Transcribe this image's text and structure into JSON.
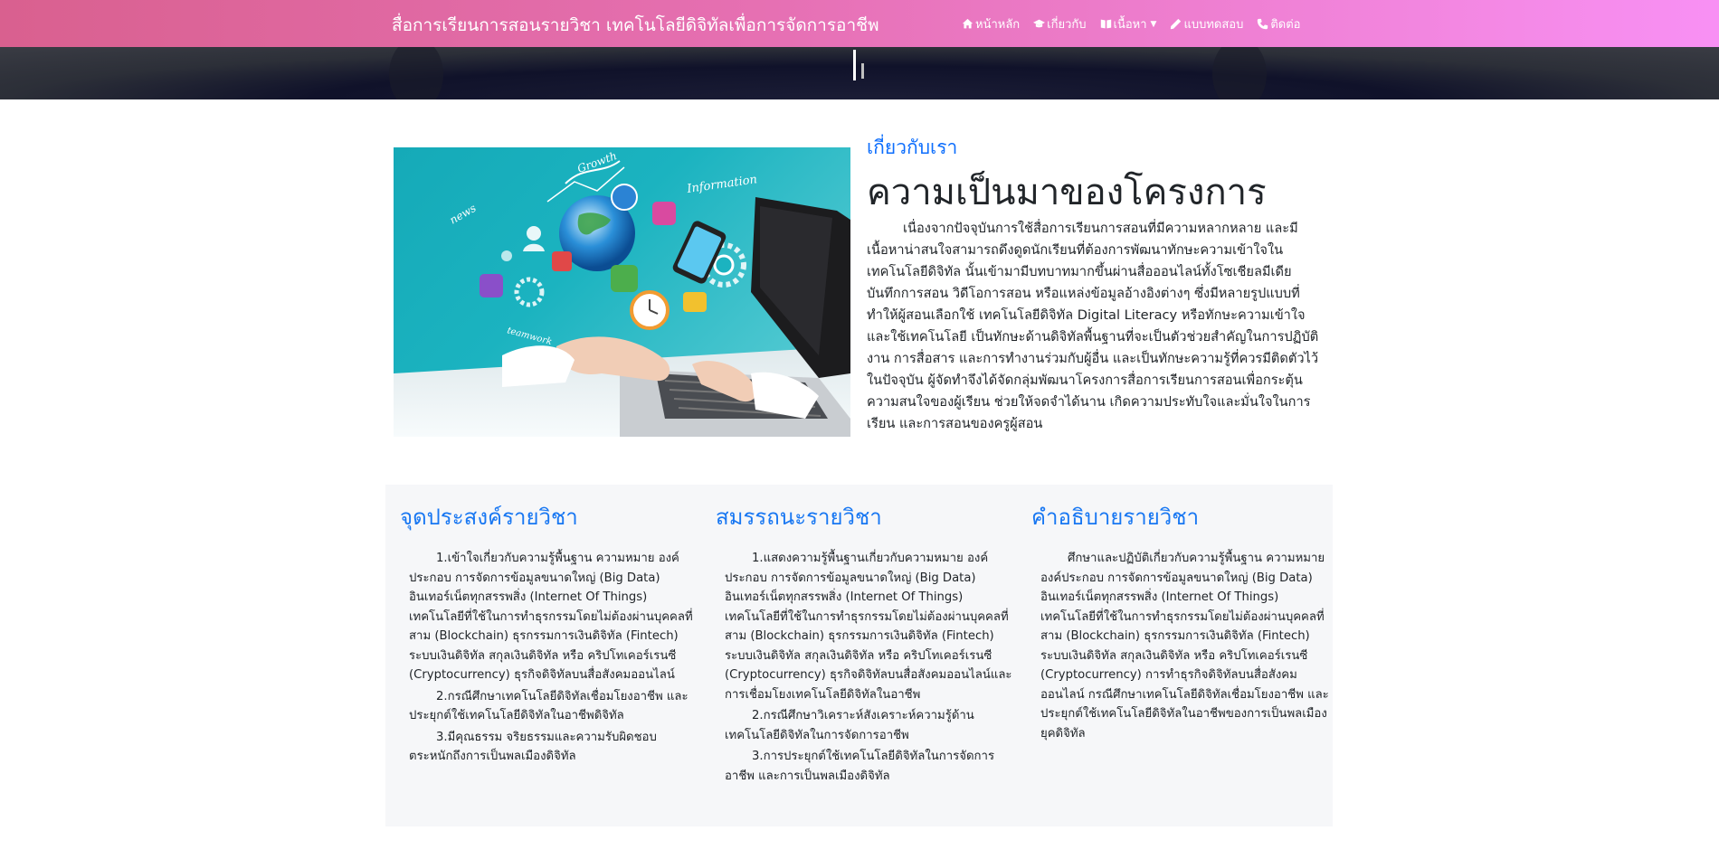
{
  "navbar": {
    "brand": "สื่อการเรียนการสอนรายวิชา เทคโนโลยีดิจิทัลเพื่อการจัดการอาชีพ",
    "links": [
      {
        "label": "หน้าหลัก",
        "icon": "home-icon"
      },
      {
        "label": "เกี่ยวกับ",
        "icon": "graduation-cap-icon"
      },
      {
        "label": "เนื้อหา",
        "icon": "book-icon",
        "dropdown": true
      },
      {
        "label": "แบบทดสอบ",
        "icon": "pencil-icon"
      },
      {
        "label": "ติดต่อ",
        "icon": "phone-icon"
      }
    ]
  },
  "about": {
    "subtitle": "เกี่ยวกับเรา",
    "title": "ความเป็นมาของโครงการ",
    "body": "เนื่องจากปัจจุบันการใช้สื่อการเรียนการสอนที่มีความหลากหลาย และมีเนื้อหาน่าสนใจสามารถดึงดูดนักเรียนที่ต้องการพัฒนาทักษะความเข้าใจในเทคโนโลยีดิจิทัล นั้นเข้ามามีบทบาทมากขึ้นผ่านสื่อออนไลน์ทั้งโซเชียลมีเดีย บันทึกการสอน วิดีโอการสอน หรือแหล่งข้อมูลอ้างอิงต่างๆ ซึ่งมีหลายรูปแบบที่ทำให้ผู้สอนเลือกใช้ เทคโนโลยีดิจิทัล Digital Literacy หรือทักษะความเข้าใจและใช้เทคโนโลยี เป็นทักษะด้านดิจิทัลพื้นฐานที่จะเป็นตัวช่วยสำคัญในการปฏิบัติงาน การสื่อสาร และการทำงานร่วมกับผู้อื่น และเป็นทักษะความรู้ที่ควรมีติดตัวไว้ในปัจจุบัน ผู้จัดทำจึงได้จัดกลุ่มพัฒนาโครงการสื่อการเรียนการสอนเพื่อกระตุ้นความสนใจของผู้เรียน ช่วยให้จดจำได้นาน เกิดความประทับใจและมั่นใจในการเรียน และการสอนของครูผู้สอน",
    "image_label_1": "Growth",
    "image_label_2": "Information",
    "image_label_3": "news",
    "image_label_4": "teamwork"
  },
  "cards": [
    {
      "title": "จุดประสงค์รายวิชา",
      "paragraphs": [
        "1.เข้าใจเกี่ยวกับความรู้พื้นฐาน ความหมาย องค์ประกอบ การจัดการข้อมูลขนาดใหญ่ (Big Data) อินเทอร์เน็ตทุกสรรพสิ่ง (Internet Of Things) เทคโนโลยีที่ใช้ในการทำธุรกรรมโดยไม่ต้องผ่านบุคคลที่สาม (Blockchain) ธุรกรรมการเงินดิจิทัล (Fintech) ระบบเงินดิจิทัล สกุลเงินดิจิทัล หรือ คริปโทเคอร์เรนซี (Cryptocurrency) ธุรกิจดิจิทัลบนสื่อสังคมออนไลน์",
        "2.กรณีศึกษาเทคโนโลยีดิจิทัลเชื่อมโยงอาชีพ และประยุกต์ใช้เทคโนโลยีดิจิทัลในอาชีพดิจิทัล",
        "3.มีคุณธรรม จริยธรรมและความรับผิดชอบ ตระหนักถึงการเป็นพลเมืองดิจิทัล"
      ]
    },
    {
      "title": "สมรรถนะรายวิชา",
      "paragraphs": [
        "1.แสดงความรู้พื้นฐานเกี่ยวกับความหมาย องค์ประกอบ การจัดการข้อมูลขนาดใหญ่ (Big Data) อินเทอร์เน็ตทุกสรรพสิ่ง (Internet Of Things) เทคโนโลยีที่ใช้ในการทำธุรกรรมโดยไม่ต้องผ่านบุคคลที่สาม (Blockchain) ธุรกรรมการเงินดิจิทัล (Fintech) ระบบเงินดิจิทัล สกุลเงินดิจิทัล หรือ คริปโทเคอร์เรนซี (Cryptocurrency) ธุรกิจดิจิทัลบนสื่อสังคมออนไลน์และการเชื่อมโยงเทคโนโลยีดิจิทัลในอาชีพ",
        "2.กรณีศึกษาวิเคราะห์สังเคราะห์ความรู้ด้านเทคโนโลยีดิจิทัลในการจัดการอาชีพ",
        "3.การประยุกต์ใช้เทคโนโลยีดิจิทัลในการจัดการอาชีพ และการเป็นพลเมืองดิจิทัล"
      ]
    },
    {
      "title": "คำอธิบายรายวิชา",
      "paragraphs": [
        "ศึกษาและปฏิบัติเกี่ยวกับความรู้พื้นฐาน ความหมาย องค์ประกอบ การจัดการข้อมูลขนาดใหญ่ (Big Data) อินเทอร์เน็ตทุกสรรพสิ่ง (Internet Of Things) เทคโนโลยีที่ใช้ในการทำธุรกรรมโดยไม่ต้องผ่านบุคคลที่สาม (Blockchain) ธุรกรรมการเงินดิจิทัล (Fintech) ระบบเงินดิจิทัล สกุลเงินดิจิทัล หรือ คริปโทเคอร์เรนซี (Cryptocurrency) การทำธุรกิจดิจิทัลบนสื่อสังคมออนไลน์ กรณีศึกษาเทคโนโลยีดิจิทัลเชื่อมโยงอาชีพ และประยุกต์ใช้เทคโนโลยีดิจิทัลในอาชีพของการเป็นพลเมืองยุคดิจิทัล"
      ]
    }
  ],
  "colors": {
    "navbar_start": "#d9608f",
    "navbar_end": "#f890f4",
    "accent_blue": "#1877f2",
    "cards_bg": "#f6f7f9"
  }
}
